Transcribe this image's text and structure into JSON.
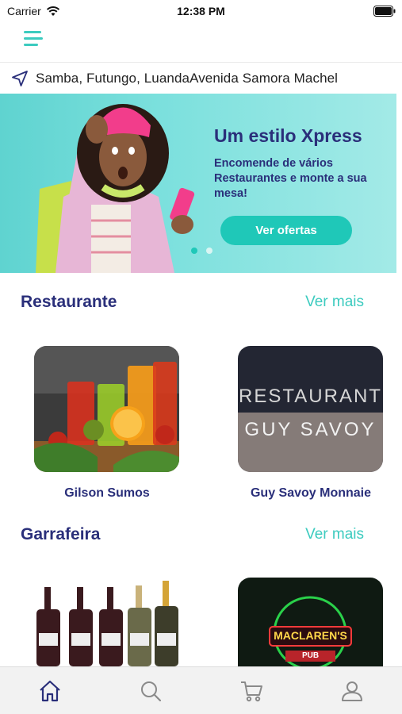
{
  "status_bar": {
    "carrier": "Carrier",
    "time": "12:38 PM"
  },
  "location": {
    "text": "Samba, Futungo, LuandaAvenida Samora Machel"
  },
  "banner": {
    "title": "Um estilo Xpress",
    "subtitle": "Encomende de vários Restaurantes e monte a sua mesa!",
    "cta": "Ver ofertas"
  },
  "sections": [
    {
      "title": "Restaurante",
      "link": "Ver mais",
      "cards": [
        {
          "name": "Gilson Sumos"
        },
        {
          "name": "Guy Savoy Monnaie",
          "sign_line1": "RESTAURANT",
          "sign_line2": "GUY SAVOY"
        }
      ]
    },
    {
      "title": "Garrafeira",
      "link": "Ver mais",
      "cards": [
        {
          "name": ""
        },
        {
          "name": "",
          "sign_line1": "MACLAREN'S",
          "sign_line2": "PUB"
        }
      ]
    }
  ],
  "tabs": [
    {
      "icon": "home-icon",
      "active": true
    },
    {
      "icon": "search-icon",
      "active": false
    },
    {
      "icon": "cart-icon",
      "active": false
    },
    {
      "icon": "profile-icon",
      "active": false
    }
  ],
  "colors": {
    "primary": "#2a2f7a",
    "accent": "#3ccbbf",
    "button": "#1fc8b8"
  }
}
